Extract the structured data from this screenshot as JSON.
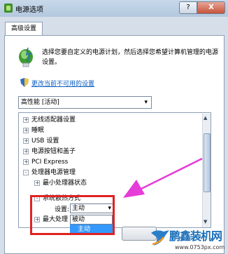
{
  "window": {
    "title": "电源选项",
    "help_label": "?",
    "close_label": "X"
  },
  "tabs": [
    {
      "label": "高级设置"
    }
  ],
  "description": "选择您要自定义的电源计划，然后选择您希望计算机管理的电源设置。",
  "change_link": "更改当前不可用的设置",
  "plan_select": {
    "value": "高性能 [活动]"
  },
  "tree": {
    "items": [
      {
        "label": "无线适配器设置",
        "expander": "+"
      },
      {
        "label": "睡眠",
        "expander": "+"
      },
      {
        "label": "USB 设置",
        "expander": "+"
      },
      {
        "label": "电源按钮和盖子",
        "expander": "+"
      },
      {
        "label": "PCI Express",
        "expander": "+"
      },
      {
        "label": "处理器电源管理",
        "expander": "-"
      },
      {
        "label": "最小处理器状态",
        "expander": "+"
      },
      {
        "label": "系统散热方式",
        "expander": "-"
      },
      {
        "label": "最大处理",
        "expander": "+"
      }
    ],
    "setting_label": "设置:",
    "setting_value": "主动",
    "dropdown_options": [
      "被动",
      "主动"
    ]
  },
  "watermark": {
    "name": "鹏鑫装机网",
    "url": "www.0753px.com"
  },
  "colors": {
    "highlight_box": "#e02222",
    "annotation_arrow": "#e63cd8",
    "selected_option": "#3399ff",
    "link": "#0b5ec2"
  }
}
